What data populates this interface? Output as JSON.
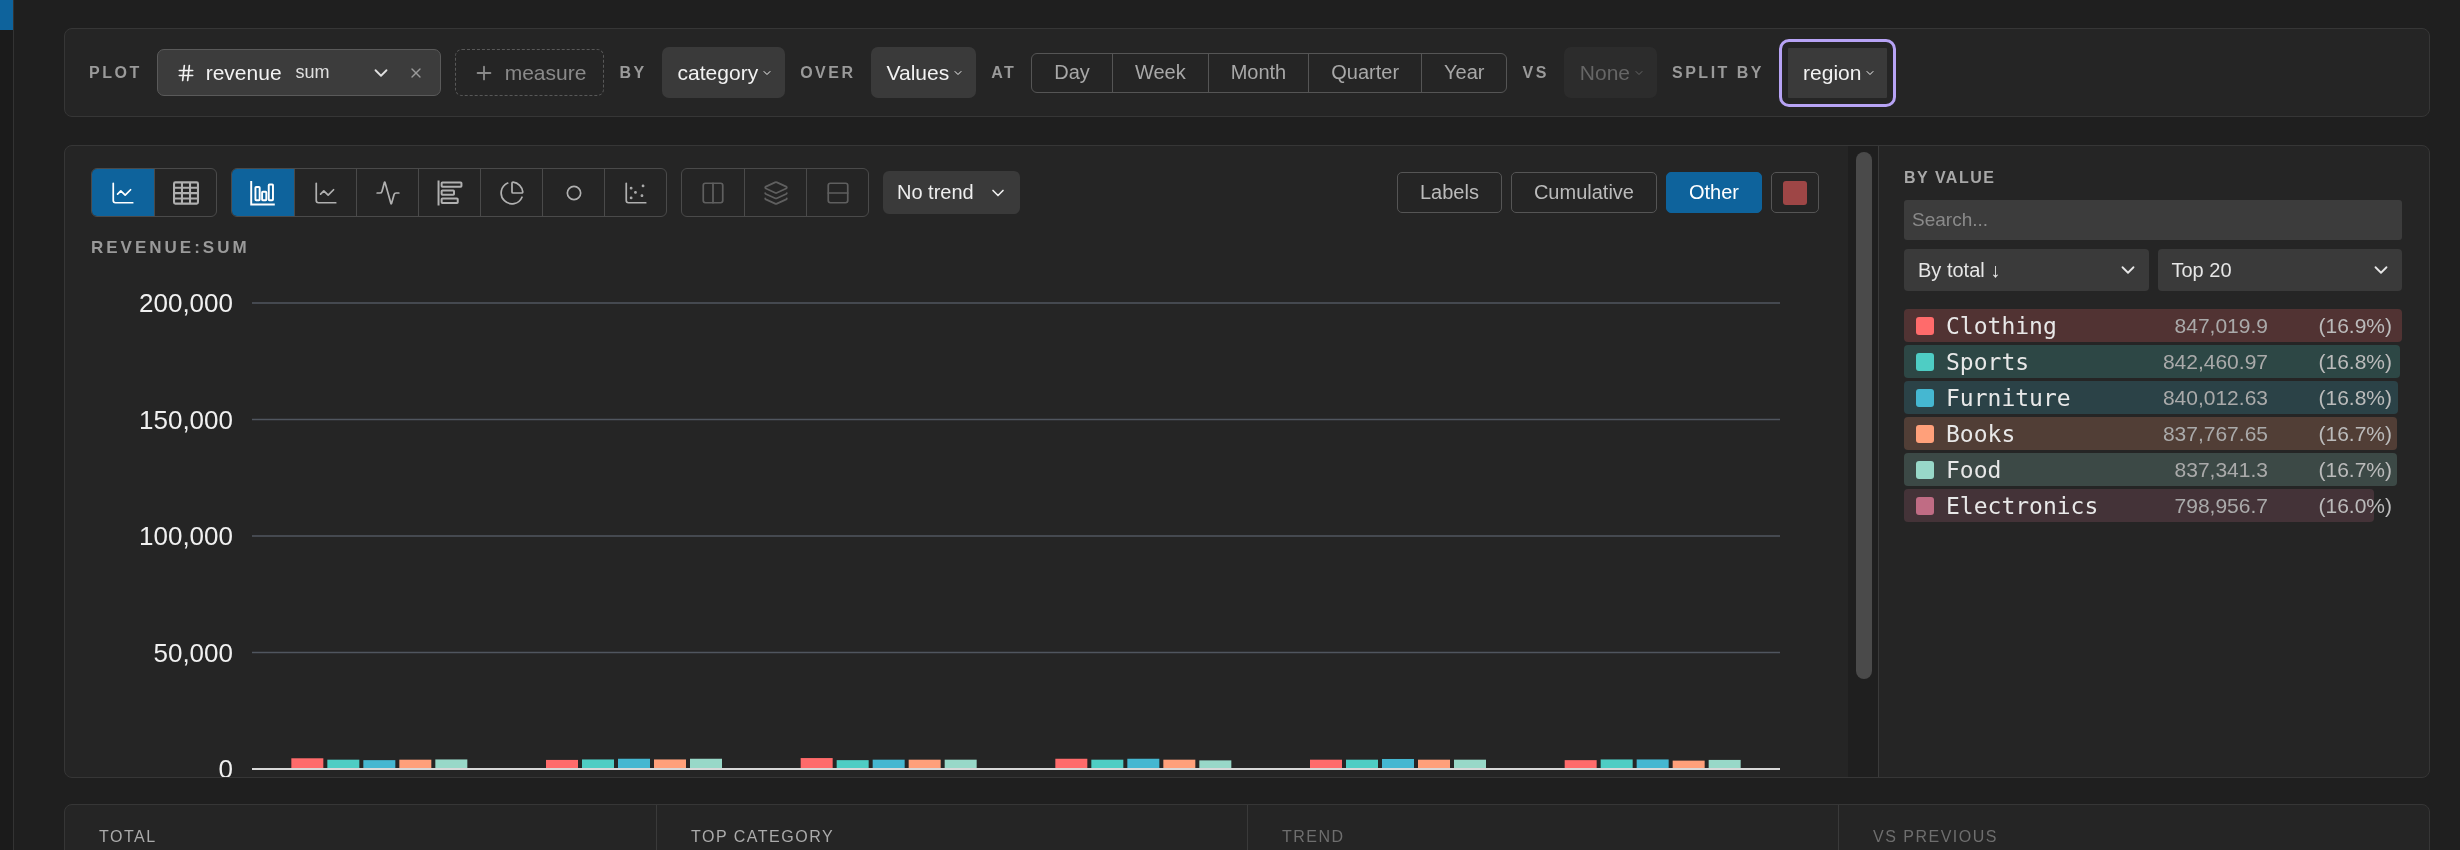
{
  "plot_bar": {
    "plot_label": "PLOT",
    "measure": {
      "field": "revenue",
      "aggregation": "sum"
    },
    "add_measure": "measure",
    "by_label": "BY",
    "by": "category",
    "over_label": "OVER",
    "over": "Values",
    "at_label": "AT",
    "intervals": [
      {
        "label": "Day",
        "selected": false
      },
      {
        "label": "Week",
        "selected": false
      },
      {
        "label": "Month",
        "selected": false
      },
      {
        "label": "Quarter",
        "selected": false
      },
      {
        "label": "Year",
        "selected": false
      }
    ],
    "vs_label": "VS",
    "compare": {
      "value": "None",
      "disabled": true
    },
    "split_label": "SPLIT BY",
    "split_by": {
      "value": "region",
      "focused": true
    }
  },
  "chart_panel": {
    "view_modes": [
      {
        "selected": true
      },
      {
        "selected": false
      }
    ],
    "chart_types": [
      {
        "selected": true
      },
      {
        "selected": false
      },
      {
        "selected": false
      },
      {
        "selected": false
      },
      {
        "selected": false
      },
      {
        "selected": false
      },
      {
        "selected": false
      }
    ],
    "layouts": [
      {
        "disabled": true
      },
      {
        "disabled": true
      },
      {
        "disabled": true
      }
    ],
    "trend": "No trend",
    "toggles": [
      {
        "label": "Labels",
        "selected": false
      },
      {
        "label": "Cumulative",
        "selected": false
      },
      {
        "label": "Other",
        "selected": true
      }
    ],
    "chart_data": {
      "type": "bar",
      "title": "REVENUE:SUM",
      "grid": true,
      "ylim": [
        0,
        200000
      ],
      "yticks": [
        {
          "value": 0,
          "label": "0"
        },
        {
          "value": 50000,
          "label": "50,000"
        },
        {
          "value": 100000,
          "label": "100,000"
        },
        {
          "value": 150000,
          "label": "150,000"
        },
        {
          "value": 200000,
          "label": "200,000"
        }
      ],
      "series": [
        {
          "color": "#ff6b6b",
          "values": [
            4600,
            3900,
            4700,
            4400,
            4000,
            3800
          ]
        },
        {
          "color": "#4ecdc4",
          "values": [
            4000,
            4100,
            3800,
            4000,
            4000,
            4100
          ]
        },
        {
          "color": "#45b7d1",
          "values": [
            3800,
            4400,
            4000,
            4400,
            4300,
            4100
          ]
        },
        {
          "color": "#ffa07a",
          "values": [
            4000,
            4100,
            4000,
            4000,
            4000,
            3600
          ]
        },
        {
          "color": "#98d8c8",
          "values": [
            4100,
            4400,
            4000,
            3700,
            4000,
            3900
          ]
        }
      ]
    }
  },
  "sidebar": {
    "title": "BY VALUE",
    "search": {
      "placeholder": "Search..."
    },
    "sort": "By total ↓",
    "limit": "Top 20",
    "items": [
      {
        "name": "Clothing",
        "value": "847,019.9",
        "share": "(16.9%)",
        "color": "#ff6b6b",
        "level": 1
      },
      {
        "name": "Sports",
        "value": "842,460.97",
        "share": "(16.8%)",
        "color": "#4ecdc4",
        "level": 0.995
      },
      {
        "name": "Furniture",
        "value": "840,012.63",
        "share": "(16.8%)",
        "color": "#45b7d1",
        "level": 0.992
      },
      {
        "name": "Books",
        "value": "837,767.65",
        "share": "(16.7%)",
        "color": "#ffa07a",
        "level": 0.989
      },
      {
        "name": "Food",
        "value": "837,341.3",
        "share": "(16.7%)",
        "color": "#98d8c8",
        "level": 0.989
      },
      {
        "name": "Electronics",
        "value": "798,956.7",
        "share": "(16.0%)",
        "color": "#c06c84",
        "level": 0.943
      }
    ]
  },
  "stats": [
    {
      "label": "TOTAL",
      "disabled": false
    },
    {
      "label": "TOP CATEGORY",
      "disabled": false
    },
    {
      "label": "TREND",
      "disabled": true
    },
    {
      "label": "VS PREVIOUS",
      "disabled": true
    }
  ]
}
